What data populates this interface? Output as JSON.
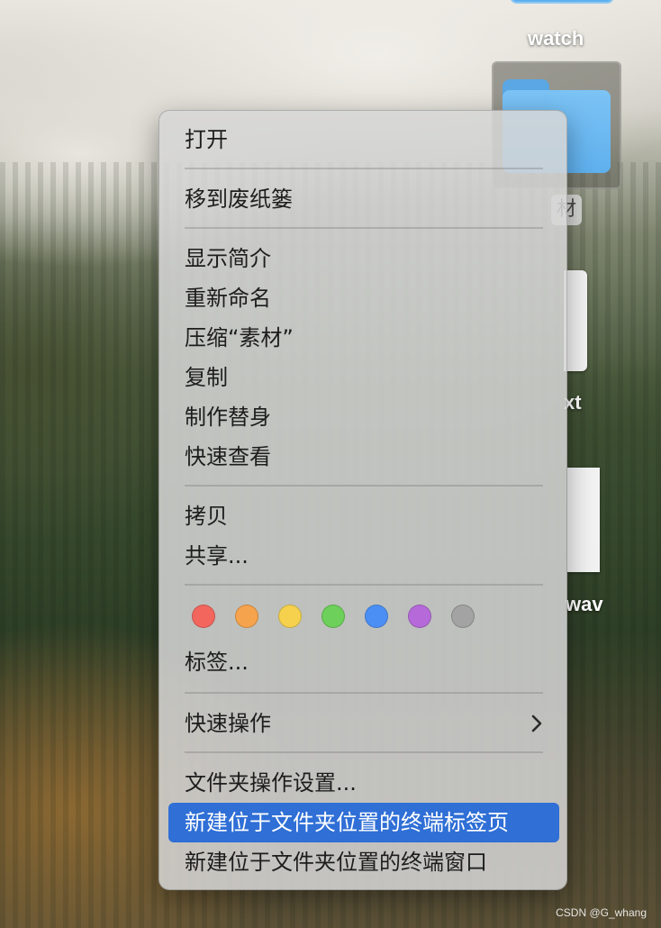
{
  "desktop": {
    "icon_labels": {
      "watch": "watch",
      "selected_partial": "材",
      "txt_partial": "xt",
      "wav_partial": "wav"
    }
  },
  "context_menu": {
    "open": "打开",
    "move_to_trash": "移到废纸篓",
    "get_info": "显示简介",
    "rename": "重新命名",
    "compress": "压缩“素材”",
    "duplicate": "复制",
    "make_alias": "制作替身",
    "quick_look": "快速查看",
    "copy": "拷贝",
    "share": "共享...",
    "tag_colors": [
      {
        "name": "red",
        "color": "#f2665e"
      },
      {
        "name": "orange",
        "color": "#f6a34d"
      },
      {
        "name": "yellow",
        "color": "#f5d14e"
      },
      {
        "name": "green",
        "color": "#6cd05a"
      },
      {
        "name": "blue",
        "color": "#4b8ff5"
      },
      {
        "name": "purple",
        "color": "#b66ad9"
      },
      {
        "name": "gray",
        "color": "#a3a3a3"
      }
    ],
    "tags": "标签...",
    "quick_actions": "快速操作",
    "folder_actions_setup": "文件夹操作设置...",
    "new_terminal_tab": "新建位于文件夹位置的终端标签页",
    "new_terminal_window": "新建位于文件夹位置的终端窗口",
    "highlight_color": "#2f6fd6"
  },
  "watermark": "CSDN @G_whang"
}
